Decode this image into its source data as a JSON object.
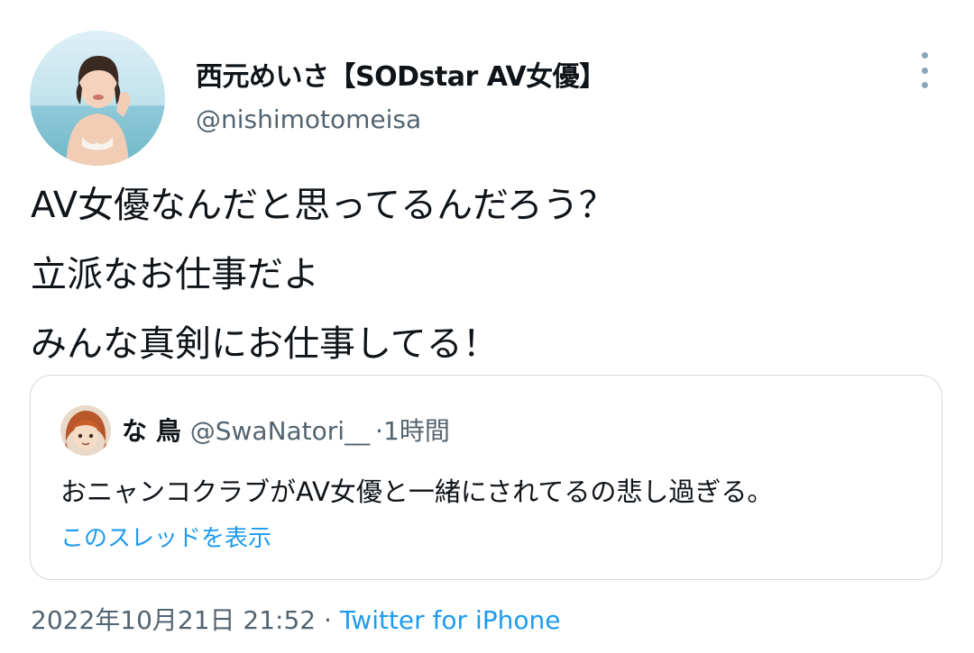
{
  "tweet": {
    "display_name": "西元めいさ【SODstar AV女優】",
    "handle": "@nishimotomeisa",
    "avatar_icon": "profile-photo-icon",
    "more_icon": "more-options-icon",
    "text_lines": [
      "AV女優なんだと思ってるんだろう？",
      "立派なお仕事だよ",
      "みんな真剣にお仕事してる！"
    ],
    "date": "2022年10月21日 21:52",
    "separator": "·",
    "source": "Twitter for iPhone"
  },
  "quoted": {
    "display_name": "な 鳥",
    "handle": "@SwaNatori__",
    "separator": "·",
    "time": "1時間",
    "avatar_icon": "profile-photo-icon",
    "text": "おニャンコクラブがAV女優と一緒にされてるの悲し過ぎる。",
    "show_thread_label": "このスレッドを表示"
  },
  "colors": {
    "text": "#0f1419",
    "secondary": "#536471",
    "link": "#1d9bf0",
    "border": "#cfd9de"
  }
}
